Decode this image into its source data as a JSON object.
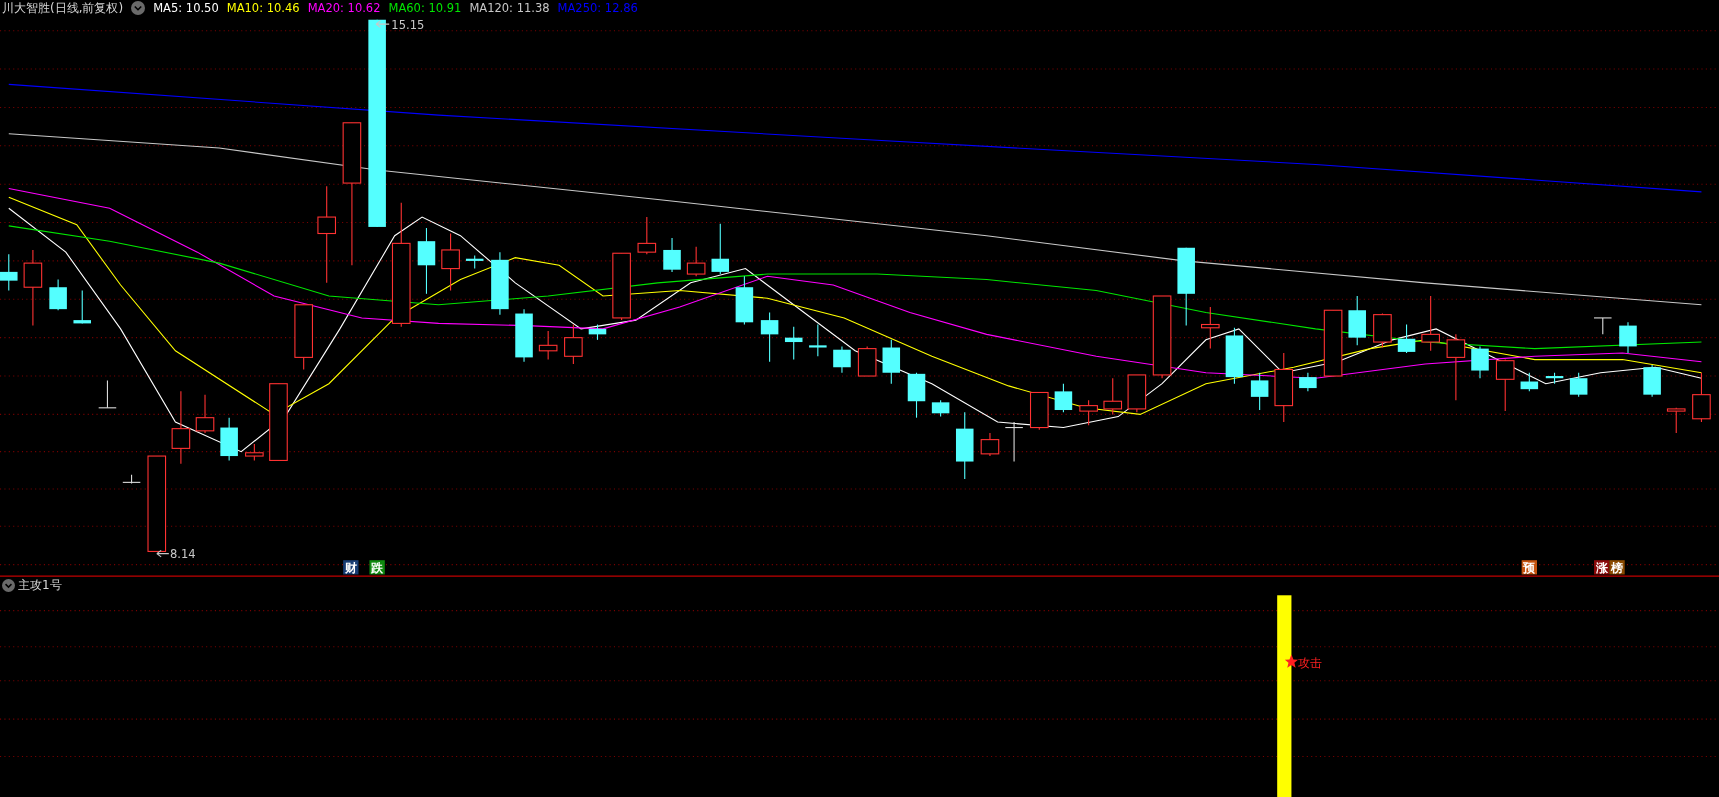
{
  "main_chart": {
    "title": "川大智胜(日线,前复权)",
    "indicators": [
      {
        "label": "MA5: 10.50",
        "color": "#ffffff"
      },
      {
        "label": "MA10: 10.46",
        "color": "#ffff00"
      },
      {
        "label": "MA20: 10.62",
        "color": "#ff00ff"
      },
      {
        "label": "MA60: 10.91",
        "color": "#00e600"
      },
      {
        "label": "MA120: 11.38",
        "color": "#c8c8c8"
      },
      {
        "label": "MA250: 12.86",
        "color": "#0000ff"
      }
    ],
    "high_label": "15.15",
    "low_label": "8.14",
    "event_markers": [
      {
        "label": "财",
        "color": "#173c73"
      },
      {
        "label": "跌",
        "color": "#0f8a0f"
      },
      {
        "label": "预",
        "color": "#c4520e"
      },
      {
        "label": "涨",
        "color": "#8a0a0a"
      },
      {
        "label": "榜",
        "color": "#8a4a00"
      }
    ]
  },
  "sub_chart": {
    "title": "主攻1号",
    "signal_label": "攻击"
  }
}
